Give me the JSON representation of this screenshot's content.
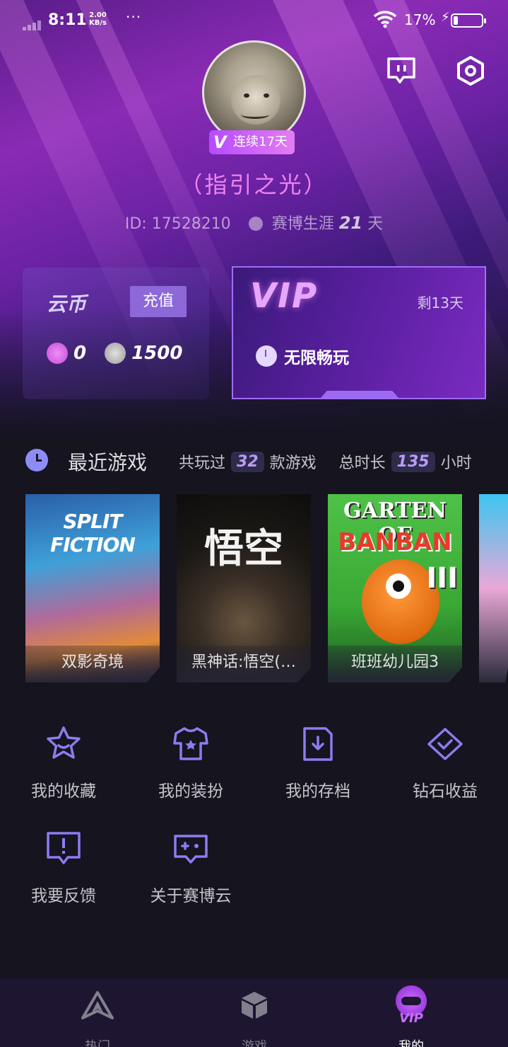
{
  "status_bar": {
    "time": "8:11",
    "net_speed_value": "2.00",
    "net_speed_unit": "KB/s",
    "more": "···",
    "battery": "17%"
  },
  "profile": {
    "streak": "连续17天",
    "username": "（指引之光）",
    "id_label": "ID:",
    "id_value": "17528210",
    "career_label": "赛博生涯",
    "career_days": "21",
    "career_unit": "天"
  },
  "coins": {
    "title": "云币",
    "recharge": "充值",
    "purple_coin": "0",
    "silver_coin": "1500"
  },
  "vip": {
    "logo": "VIP",
    "remaining": "剩13天",
    "perk": "无限畅玩"
  },
  "recent": {
    "title": "最近游戏",
    "played_prefix": "共玩过",
    "played_count": "32",
    "played_suffix": "款游戏",
    "hours_prefix": "总时长",
    "hours_count": "135",
    "hours_suffix": "小时",
    "games": [
      {
        "name": "双影奇境",
        "art_text": "SPLIT FICTION"
      },
      {
        "name": "黑神话:悟空(…",
        "art_text": "悟空"
      },
      {
        "name": "班班幼儿园3",
        "art_text_1": "GARTEN OF",
        "art_text_2": "BANBAN",
        "art_text_3": "III"
      }
    ]
  },
  "menu": {
    "items": [
      {
        "label": "我的收藏",
        "icon": "star-icon"
      },
      {
        "label": "我的装扮",
        "icon": "tshirt-icon"
      },
      {
        "label": "我的存档",
        "icon": "save-file-icon"
      },
      {
        "label": "钻石收益",
        "icon": "diamond-icon"
      },
      {
        "label": "我要反馈",
        "icon": "feedback-icon"
      },
      {
        "label": "关于赛博云",
        "icon": "gamepad-icon"
      }
    ]
  },
  "tabbar": {
    "tabs": [
      {
        "label": "热门"
      },
      {
        "label": "游戏"
      },
      {
        "label": "我的"
      }
    ],
    "vip_badge": "VIP"
  },
  "colors": {
    "accent_purple": "#8c68d8",
    "username_pink": "#f083ef",
    "background": "#15141f",
    "menu_icon": "#8c7cf0"
  }
}
